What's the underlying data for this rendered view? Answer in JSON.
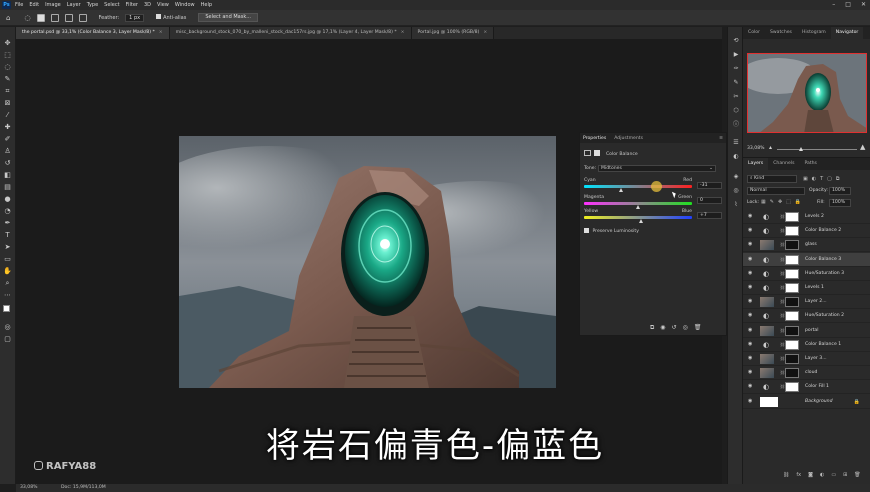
{
  "menubar": {
    "items": [
      "File",
      "Edit",
      "Image",
      "Layer",
      "Type",
      "Select",
      "Filter",
      "3D",
      "View",
      "Window",
      "Help"
    ]
  },
  "options": {
    "feather_label": "Feather:",
    "feather_value": "1 px",
    "antialias_label": "Anti-alias",
    "select_mask_label": "Select and Mask..."
  },
  "tabs": [
    {
      "label": "the portal.psd @ 33,1% (Color Balance 3, Layer Mask/8) *",
      "active": true
    },
    {
      "label": "misc_background_stock_070_by_malleni_stock_dac157rs.jpg @ 17,1% (Layer 4, Layer Mask/8) *",
      "active": false
    },
    {
      "label": "Portal.jpg @ 100% (RGB/8)",
      "active": false
    }
  ],
  "properties": {
    "tab_properties": "Properties",
    "tab_adjustments": "Adjustments",
    "panel_title": "Color Balance",
    "tone_label": "Tone:",
    "tone_value": "Midtones",
    "cyan": "Cyan",
    "red": "Red",
    "cyan_red_value": "-31",
    "cyan_red": -31,
    "magenta": "Magenta",
    "green": "Green",
    "magenta_green_value": "0",
    "magenta_green": 0,
    "yellow": "Yellow",
    "blue": "Blue",
    "yellow_blue_value": "+7",
    "yellow_blue": 7,
    "preserve_label": "Preserve Luminosity"
  },
  "navigator": {
    "tabs": [
      "Color",
      "Swatches",
      "Histogram",
      "Navigator"
    ],
    "active_tab": "Navigator",
    "zoom": "33,08%"
  },
  "layers_panel": {
    "tabs": [
      "Layers",
      "Channels",
      "Paths"
    ],
    "kind_label": "Kind",
    "blend_mode": "Normal",
    "opacity_label": "Opacity:",
    "opacity_value": "100%",
    "lock_label": "Lock:",
    "fill_label": "Fill:",
    "fill_value": "100%",
    "layers": [
      {
        "name": "Levels 2",
        "thumb": "adj",
        "selected": false
      },
      {
        "name": "Color Balance 2",
        "thumb": "adj",
        "selected": false
      },
      {
        "name": "glass",
        "thumb": "img",
        "selected": false
      },
      {
        "name": "Color Balance 3",
        "thumb": "adj",
        "selected": true
      },
      {
        "name": "Hue/Saturation 3",
        "thumb": "adj",
        "selected": false
      },
      {
        "name": "Levels 1",
        "thumb": "adj",
        "selected": false
      },
      {
        "name": "Layer 2...",
        "thumb": "img",
        "selected": false
      },
      {
        "name": "Hue/Saturation 2",
        "thumb": "adj",
        "selected": false
      },
      {
        "name": "portal",
        "thumb": "img",
        "selected": false
      },
      {
        "name": "Color Balance 1",
        "thumb": "adj",
        "selected": false
      },
      {
        "name": "Layer 3...",
        "thumb": "img",
        "selected": false
      },
      {
        "name": "cloud",
        "thumb": "img",
        "selected": false
      },
      {
        "name": "Color Fill 1",
        "thumb": "adj",
        "selected": false
      },
      {
        "name": "Background",
        "thumb": "white",
        "selected": false
      }
    ]
  },
  "status": {
    "zoom": "33,08%",
    "doc": "Doc: 15,9M/113,0M"
  },
  "caption": "将岩石偏青色-偏蓝色",
  "watermark": "RAFYA88"
}
